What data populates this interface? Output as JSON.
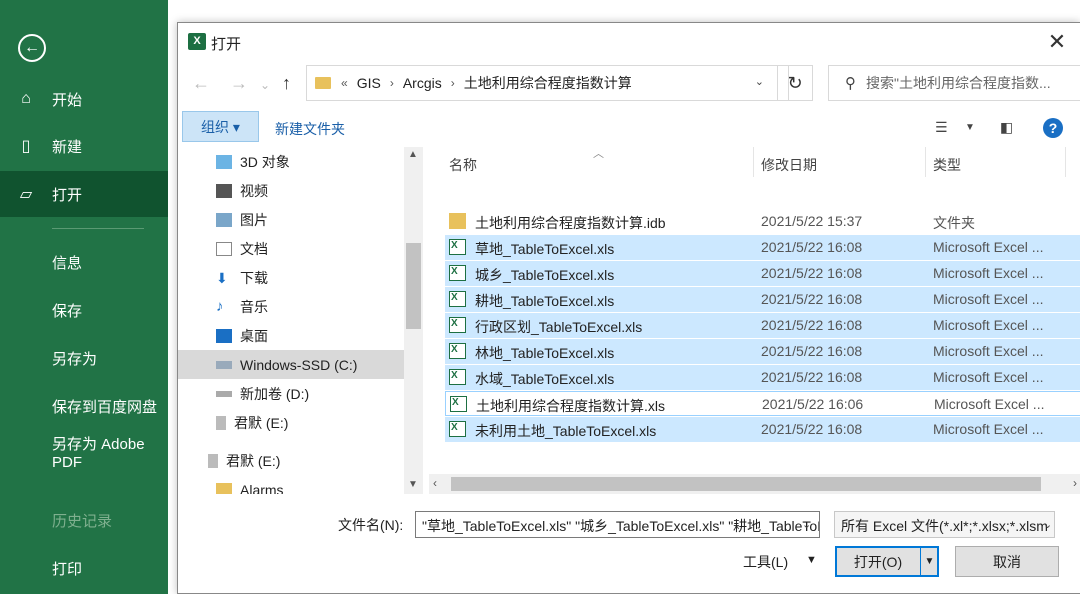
{
  "backstage": {
    "back_icon": "back-arrow-icon",
    "items": [
      {
        "label": "开始",
        "icon": "home-icon"
      },
      {
        "label": "新建",
        "icon": "new-document-icon"
      },
      {
        "label": "打开",
        "icon": "open-folder-icon"
      },
      {
        "label": "信息"
      },
      {
        "label": "保存"
      },
      {
        "label": "另存为"
      },
      {
        "label": "保存到百度网盘"
      },
      {
        "label": "另存为 Adobe PDF"
      },
      {
        "label": "历史记录"
      },
      {
        "label": "打印"
      }
    ],
    "accent": "#217346",
    "active_bg": "#10532f"
  },
  "dialog": {
    "title": "打开",
    "close": "✕",
    "address": {
      "prefix": "«",
      "crumbs": [
        "GIS",
        "Arcgis",
        "土地利用综合程度指数计算"
      ]
    },
    "search_placeholder": "搜索\"土地利用综合程度指数...",
    "organize": "组织 ▾",
    "new_folder": "新建文件夹",
    "tree": [
      {
        "label": "3D 对象",
        "icon": "3d-objects-icon"
      },
      {
        "label": "视频",
        "icon": "video-icon"
      },
      {
        "label": "图片",
        "icon": "pictures-icon"
      },
      {
        "label": "文档",
        "icon": "documents-icon"
      },
      {
        "label": "下载",
        "icon": "download-icon"
      },
      {
        "label": "音乐",
        "icon": "music-icon"
      },
      {
        "label": "桌面",
        "icon": "desktop-icon"
      },
      {
        "label": "Windows-SSD (C:)",
        "icon": "drive-icon"
      },
      {
        "label": "新加卷 (D:)",
        "icon": "drive-icon"
      },
      {
        "label": "君默 (E:)",
        "icon": "usb-drive-icon"
      },
      {
        "label": "君默 (E:)",
        "icon": "usb-drive-icon"
      },
      {
        "label": "Alarms",
        "icon": "folder-icon"
      }
    ],
    "columns": {
      "name": "名称",
      "modified": "修改日期",
      "type": "类型"
    },
    "files": [
      {
        "name": "土地利用综合程度指数计算.idb",
        "date": "2021/5/22 15:37",
        "type": "文件夹",
        "kind": "folder",
        "selected": false
      },
      {
        "name": "草地_TableToExcel.xls",
        "date": "2021/5/22 16:08",
        "type": "Microsoft Excel ...",
        "kind": "xls",
        "selected": true
      },
      {
        "name": "城乡_TableToExcel.xls",
        "date": "2021/5/22 16:08",
        "type": "Microsoft Excel ...",
        "kind": "xls",
        "selected": true
      },
      {
        "name": "耕地_TableToExcel.xls",
        "date": "2021/5/22 16:08",
        "type": "Microsoft Excel ...",
        "kind": "xls",
        "selected": true
      },
      {
        "name": "行政区划_TableToExcel.xls",
        "date": "2021/5/22 16:08",
        "type": "Microsoft Excel ...",
        "kind": "xls",
        "selected": true
      },
      {
        "name": "林地_TableToExcel.xls",
        "date": "2021/5/22 16:08",
        "type": "Microsoft Excel ...",
        "kind": "xls",
        "selected": true
      },
      {
        "name": "水域_TableToExcel.xls",
        "date": "2021/5/22 16:08",
        "type": "Microsoft Excel ...",
        "kind": "xls",
        "selected": true
      },
      {
        "name": "土地利用综合程度指数计算.xls",
        "date": "2021/5/22 16:06",
        "type": "Microsoft Excel ...",
        "kind": "xls",
        "selected": false
      },
      {
        "name": "未利用土地_TableToExcel.xls",
        "date": "2021/5/22 16:08",
        "type": "Microsoft Excel ...",
        "kind": "xls",
        "selected": true
      }
    ],
    "filename_label": "文件名(N):",
    "filename_value": "\"草地_TableToExcel.xls\" \"城乡_TableToExcel.xls\" \"耕地_TableToExcel.xls\"",
    "filter": "所有 Excel 文件(*.xl*;*.xlsx;*.xlsm",
    "tools": "工具(L)",
    "open": "打开(O)",
    "cancel": "取消"
  }
}
